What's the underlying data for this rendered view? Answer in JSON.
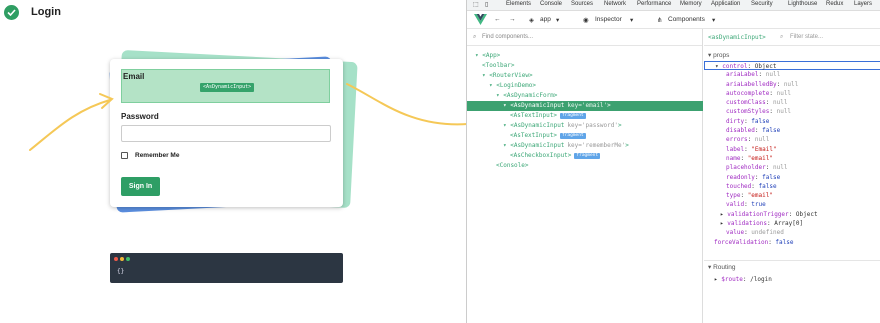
{
  "app": {
    "title": "Login"
  },
  "form": {
    "email_label": "Email",
    "email_tag": "<AsDynamicInput>",
    "password_label": "Password",
    "remember_label": "Remember Me",
    "signin_label": "Sign In"
  },
  "code": {
    "text": "{}"
  },
  "devtools": {
    "tabs": [
      "Elements",
      "Console",
      "Sources",
      "Network",
      "Performance",
      "Memory",
      "Application",
      "Security",
      "Lighthouse",
      "Redux",
      "Layers"
    ],
    "vue_bar": {
      "app_label": "app",
      "inspector_label": "Inspector",
      "components_label": "Components"
    },
    "find_placeholder": "Find components...",
    "tree": [
      {
        "indent": 0,
        "toggle": "▾",
        "name": "<App>",
        "key": "",
        "frag": ""
      },
      {
        "indent": 1,
        "toggle": "",
        "name": "<Toolbar>",
        "key": "",
        "frag": ""
      },
      {
        "indent": 1,
        "toggle": "▾",
        "name": "<RouterView>",
        "key": "",
        "frag": ""
      },
      {
        "indent": 2,
        "toggle": "▾",
        "name": "<LoginDemo>",
        "key": "",
        "frag": ""
      },
      {
        "indent": 3,
        "toggle": "▾",
        "name": "<AsDynamicForm>",
        "key": "",
        "frag": ""
      },
      {
        "indent": 4,
        "toggle": "▾",
        "name": "<AsDynamicInput",
        "key": "key='email'",
        "frag": "",
        "close": ">",
        "selected": true
      },
      {
        "indent": 5,
        "toggle": "",
        "name": "<AsTextInput>",
        "key": "",
        "frag": "fragment"
      },
      {
        "indent": 4,
        "toggle": "▾",
        "name": "<AsDynamicInput",
        "key": "key='password'",
        "frag": "",
        "close": ">"
      },
      {
        "indent": 5,
        "toggle": "",
        "name": "<AsTextInput>",
        "key": "",
        "frag": "fragment"
      },
      {
        "indent": 4,
        "toggle": "▾",
        "name": "<AsDynamicInput",
        "key": "key='rememberMe'",
        "frag": "",
        "close": ">"
      },
      {
        "indent": 5,
        "toggle": "",
        "name": "<AsCheckboxInput>",
        "key": "",
        "frag": "fragment"
      },
      {
        "indent": 3,
        "toggle": "",
        "name": "<Console>",
        "key": "",
        "frag": ""
      }
    ],
    "selected_component": "<asDynamicInput>",
    "filter_placeholder": "Filter state...",
    "props_section": "props",
    "props": [
      {
        "indent": 1,
        "toggle": "▾",
        "key": "control",
        "sep": ": ",
        "val": "Object",
        "type": "obj",
        "ctrl": true
      },
      {
        "indent": 3,
        "toggle": "",
        "key": "ariaLabel",
        "sep": ": ",
        "val": "null",
        "type": "null"
      },
      {
        "indent": 3,
        "toggle": "",
        "key": "ariaLabelledBy",
        "sep": ": ",
        "val": "null",
        "type": "null"
      },
      {
        "indent": 3,
        "toggle": "",
        "key": "autocomplete",
        "sep": ": ",
        "val": "null",
        "type": "null"
      },
      {
        "indent": 3,
        "toggle": "",
        "key": "customClass",
        "sep": ": ",
        "val": "null",
        "type": "null"
      },
      {
        "indent": 3,
        "toggle": "",
        "key": "customStyles",
        "sep": ": ",
        "val": "null",
        "type": "null"
      },
      {
        "indent": 3,
        "toggle": "",
        "key": "dirty",
        "sep": ": ",
        "val": "false",
        "type": "bool"
      },
      {
        "indent": 3,
        "toggle": "",
        "key": "disabled",
        "sep": ": ",
        "val": "false",
        "type": "bool"
      },
      {
        "indent": 3,
        "toggle": "",
        "key": "errors",
        "sep": ": ",
        "val": "null",
        "type": "null"
      },
      {
        "indent": 3,
        "toggle": "",
        "key": "label",
        "sep": ": ",
        "val": "\"Email\"",
        "type": "str"
      },
      {
        "indent": 3,
        "toggle": "",
        "key": "name",
        "sep": ": ",
        "val": "\"email\"",
        "type": "str"
      },
      {
        "indent": 3,
        "toggle": "",
        "key": "placeholder",
        "sep": ": ",
        "val": "null",
        "type": "null"
      },
      {
        "indent": 3,
        "toggle": "",
        "key": "readonly",
        "sep": ": ",
        "val": "false",
        "type": "bool"
      },
      {
        "indent": 3,
        "toggle": "",
        "key": "touched",
        "sep": ": ",
        "val": "false",
        "type": "bool"
      },
      {
        "indent": 3,
        "toggle": "",
        "key": "type",
        "sep": ": ",
        "val": "\"email\"",
        "type": "str"
      },
      {
        "indent": 3,
        "toggle": "",
        "key": "valid",
        "sep": ": ",
        "val": "true",
        "type": "bool"
      },
      {
        "indent": 2,
        "toggle": "▸",
        "key": "validationTrigger",
        "sep": ": ",
        "val": "Object",
        "type": "obj"
      },
      {
        "indent": 2,
        "toggle": "▸",
        "key": "validations",
        "sep": ": ",
        "val": "Array[0]",
        "type": "obj"
      },
      {
        "indent": 3,
        "toggle": "",
        "key": "value",
        "sep": ": ",
        "val": "undefined",
        "type": "null"
      },
      {
        "indent": 1,
        "toggle": "",
        "key": "forceValidation",
        "sep": ": ",
        "val": "false",
        "type": "bool"
      }
    ],
    "routing_section": "Routing",
    "route": {
      "key": "$route",
      "sep": ": ",
      "val": "/login"
    }
  }
}
